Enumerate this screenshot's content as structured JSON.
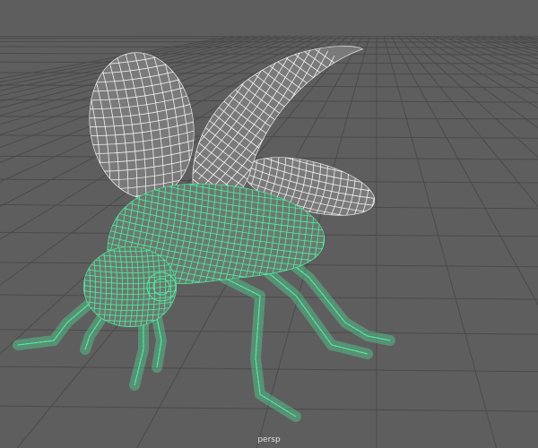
{
  "viewport": {
    "camera_label": "persp",
    "colors": {
      "background": "#5e5e5e",
      "grid": "#4a4a4a",
      "wing_wire": "#f2f2f2",
      "wing_fill": "#7a7a7a",
      "body_wire": "#4ef0a0",
      "body_fill": "#6a7a70"
    }
  }
}
